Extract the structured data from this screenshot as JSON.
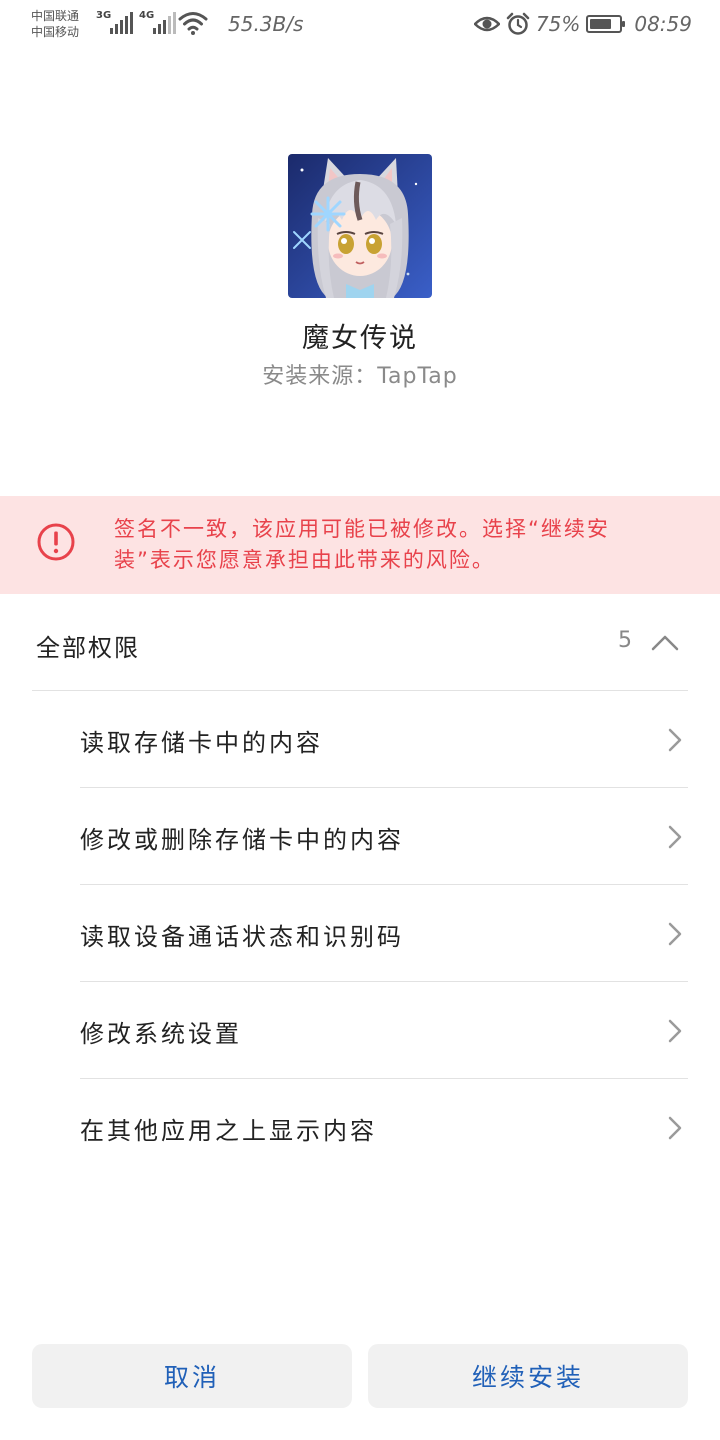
{
  "status_bar": {
    "carrier_1": "中国联通",
    "carrier_2": "中国移动",
    "network_1": "3G",
    "network_2": "4G",
    "speed": "55.3B/s",
    "battery_percent": "75%",
    "battery_level": 0.75,
    "time": "08:59",
    "icons": [
      "signal-icon",
      "wifi-icon",
      "eye-icon",
      "alarm-icon",
      "battery-icon"
    ]
  },
  "app": {
    "name": "魔女传说",
    "source": "安装来源：TapTap"
  },
  "warning": {
    "text": "签名不一致，该应用可能已被修改。选择“继续安装”表示您愿意承担由此带来的风险。",
    "color": "#e8424b",
    "background": "#fde3e3"
  },
  "permissions": {
    "title": "全部权限",
    "count": "5",
    "items": [
      {
        "label": "读取存储卡中的内容"
      },
      {
        "label": "修改或删除存储卡中的内容"
      },
      {
        "label": "读取设备通话状态和识别码"
      },
      {
        "label": "修改系统设置"
      },
      {
        "label": "在其他应用之上显示内容"
      }
    ]
  },
  "buttons": {
    "cancel": "取消",
    "install": "继续安装",
    "accent_color": "#2060b8"
  }
}
